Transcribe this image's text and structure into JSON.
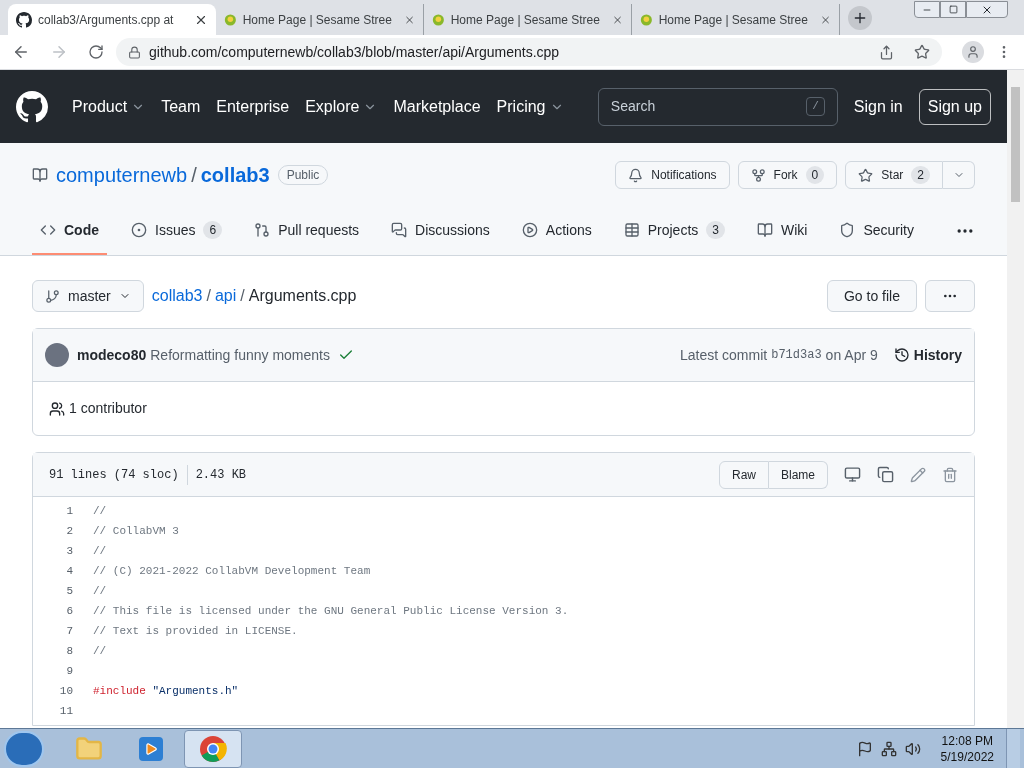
{
  "browser": {
    "tabs": [
      {
        "title": "collab3/Arguments.cpp at",
        "kind": "github",
        "selected": true
      },
      {
        "title": "Home Page | Sesame Stree",
        "kind": "site",
        "selected": false
      },
      {
        "title": "Home Page | Sesame Stree",
        "kind": "site",
        "selected": false
      },
      {
        "title": "Home Page | Sesame Stree",
        "kind": "site",
        "selected": false
      }
    ],
    "url": "github.com/computernewb/collab3/blob/master/api/Arguments.cpp"
  },
  "header": {
    "nav": [
      {
        "label": "Product",
        "dropdown": true
      },
      {
        "label": "Team",
        "dropdown": false
      },
      {
        "label": "Enterprise",
        "dropdown": false
      },
      {
        "label": "Explore",
        "dropdown": true
      },
      {
        "label": "Marketplace",
        "dropdown": false
      },
      {
        "label": "Pricing",
        "dropdown": true
      }
    ],
    "search": {
      "placeholder": "Search",
      "shortcut": "/"
    },
    "sign_in": "Sign in",
    "sign_up": "Sign up"
  },
  "repo": {
    "owner": "computernewb",
    "name": "collab3",
    "visibility": "Public",
    "actions": [
      {
        "label": "Notifications",
        "kind": "bell"
      },
      {
        "label": "Fork",
        "kind": "fork",
        "count": "0"
      },
      {
        "label": "Star",
        "kind": "star",
        "count": "2"
      }
    ],
    "separator": "/",
    "tabs": [
      {
        "label": "Code",
        "kind": "code",
        "selected": true
      },
      {
        "label": "Issues",
        "kind": "issue",
        "count": "6",
        "selected": false
      },
      {
        "label": "Pull requests",
        "kind": "pr",
        "selected": false
      },
      {
        "label": "Discussions",
        "kind": "discuss",
        "selected": false
      },
      {
        "label": "Actions",
        "kind": "play",
        "selected": false
      },
      {
        "label": "Projects",
        "kind": "table",
        "count": "3",
        "selected": false
      },
      {
        "label": "Wiki",
        "kind": "book",
        "selected": false
      },
      {
        "label": "Security",
        "kind": "shield",
        "selected": false
      }
    ]
  },
  "file": {
    "branch": "master",
    "separator": "/",
    "path": [
      {
        "label": "collab3",
        "link": true
      },
      {
        "label": "api",
        "link": true
      },
      {
        "label": "Arguments.cpp",
        "link": false
      }
    ],
    "go_to_file": "Go to file",
    "commit": {
      "author": "modeco80",
      "message": "Reformatting funny moments",
      "checks_passed": true,
      "prefix": "Latest commit",
      "sha": "b71d3a3",
      "date": "on Apr 9",
      "history": "History"
    },
    "contributors": "1 contributor",
    "lines_info": "91 lines (74 sloc)",
    "size": "2.43 KB",
    "buttons": [
      "Raw",
      "Blame"
    ],
    "code": [
      {
        "number": "1",
        "segments": [
          {
            "text": "//",
            "kind": "comment"
          }
        ]
      },
      {
        "number": "2",
        "segments": [
          {
            "text": "// CollabVM 3",
            "kind": "comment"
          }
        ]
      },
      {
        "number": "3",
        "segments": [
          {
            "text": "//",
            "kind": "comment"
          }
        ]
      },
      {
        "number": "4",
        "segments": [
          {
            "text": "// (C) 2021-2022 CollabVM Development Team",
            "kind": "comment"
          }
        ]
      },
      {
        "number": "5",
        "segments": [
          {
            "text": "//",
            "kind": "comment"
          }
        ]
      },
      {
        "number": "6",
        "segments": [
          {
            "text": "// This file is licensed under the GNU General Public License Version 3.",
            "kind": "comment"
          }
        ]
      },
      {
        "number": "7",
        "segments": [
          {
            "text": "// Text is provided in LICENSE.",
            "kind": "comment"
          }
        ]
      },
      {
        "number": "8",
        "segments": [
          {
            "text": "//",
            "kind": "comment"
          }
        ]
      },
      {
        "number": "9"
      },
      {
        "number": "10",
        "segments": [
          {
            "text": "#include",
            "kind": "keyword"
          },
          {
            "text": "\"Arguments.h\"",
            "kind": "string"
          }
        ]
      },
      {
        "number": "11"
      }
    ]
  },
  "taskbar": {
    "apps": [
      {
        "kind": "folder",
        "selected": false
      },
      {
        "kind": "media",
        "selected": false
      },
      {
        "kind": "chrome",
        "selected": true
      }
    ],
    "time": "12:08 PM",
    "date": "5/19/2022"
  }
}
